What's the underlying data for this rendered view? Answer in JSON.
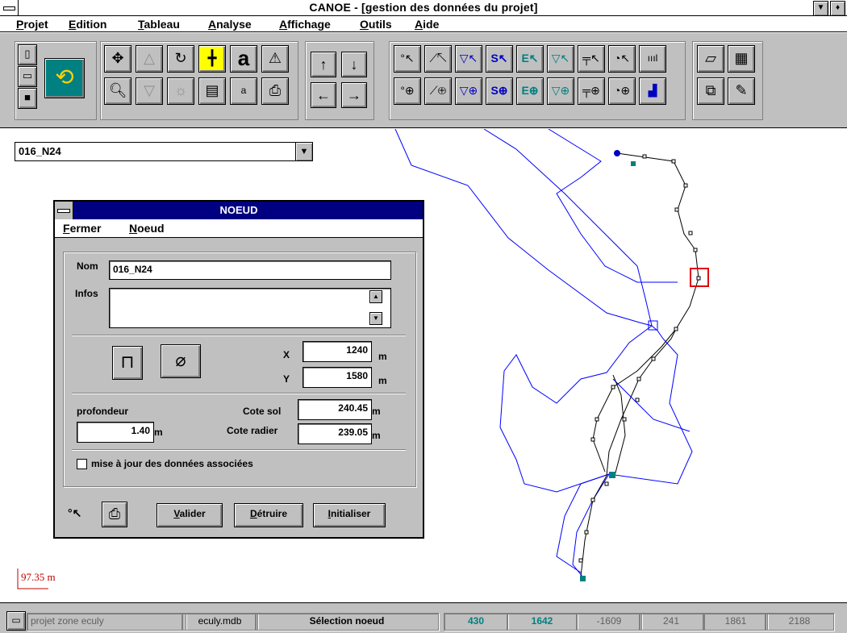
{
  "window": {
    "title": "CANOE - [gestion des données du projet]"
  },
  "menubar": {
    "items": [
      "Projet",
      "Edition",
      "Tableau",
      "Analyse",
      "Affichage",
      "Outils",
      "Aide"
    ]
  },
  "toolbar": {
    "icons": {
      "new": "new-file-icon",
      "open": "open-folder-icon",
      "save": "save-disk-icon",
      "refresh": "refresh-cycle-icon",
      "move": "move-cross-icon",
      "text_large": "a",
      "text_small": "a"
    },
    "accent": "#008080",
    "select_blue": "#0000c0",
    "chart_label": "ıııl"
  },
  "combo": {
    "value": "016_N24"
  },
  "dialog": {
    "title": "NOEUD",
    "menu": [
      "Fermer",
      "Noeud"
    ],
    "nom_label": "Nom",
    "nom_value": "016_N24",
    "infos_label": "Infos",
    "infos_value": "",
    "x_label": "X",
    "x_value": "1240",
    "y_label": "Y",
    "y_value": "1580",
    "unit_m": "m",
    "profondeur_label": "profondeur",
    "profondeur_value": "1.40",
    "cote_sol_label": "Cote sol",
    "cote_sol_value": "240.45",
    "cote_radier_label": "Cote radier",
    "cote_radier_value": "239.05",
    "checkbox_label": "mise à jour des données associées",
    "checkbox_checked": false,
    "btn_valider": "Valider",
    "btn_detruire": "Détruire",
    "btn_initialiser": "Initialiser"
  },
  "map": {
    "scale_label": "97.35 m",
    "network_color": "#0000ff",
    "pipe_color": "#000000",
    "selection_color": "#e00000",
    "outlet_color": "#008080"
  },
  "statusbar": {
    "project": "projet zone eculy",
    "file": "eculy.mdb",
    "mode": "Sélection noeud",
    "values": [
      "430",
      "1642",
      "-1609",
      "241",
      "1861",
      "2188"
    ]
  }
}
